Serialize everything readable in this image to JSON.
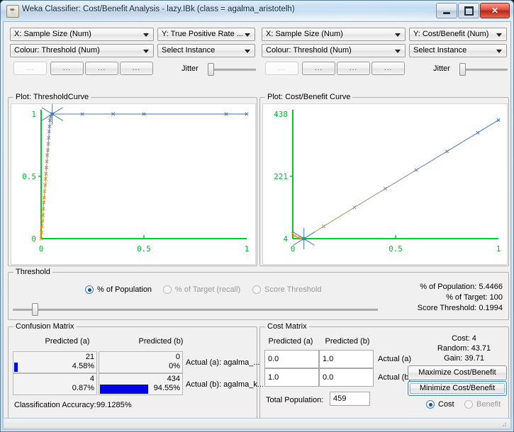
{
  "window": {
    "title": "Weka Classifier: Cost/Benefit Analysis - lazy.IBk  (class = agalma_aristotelh)",
    "icon": "weka-coffee-icon",
    "minimize": "minimize-icon",
    "maximize": "maximize-icon",
    "close": "✕"
  },
  "left_controls": {
    "x_axis": "X: Sample Size (Num)",
    "y_axis": "Y: True Positive Rate ...",
    "colour": "Colour: Threshold (Num)",
    "select_instance": "Select Instance",
    "buttons": [
      "...",
      "...",
      "...",
      "..."
    ],
    "jitter_label": "Jitter"
  },
  "right_controls": {
    "x_axis": "X: Sample Size (Num)",
    "y_axis": "Y: Cost/Benefit (Num)",
    "colour": "Colour: Threshold (Num)",
    "select_instance": "Select Instance",
    "buttons": [
      "...",
      "...",
      "...",
      "..."
    ],
    "jitter_label": "Jitter"
  },
  "threshold_panel": {
    "title": "Threshold",
    "options": [
      {
        "label": "% of Population",
        "selected": true
      },
      {
        "label": "% of Target (recall)",
        "selected": false
      },
      {
        "label": "Score Threshold",
        "selected": false
      }
    ],
    "stats": [
      "% of Population: 5.4466",
      "% of Target: 100",
      "Score Threshold: 0.1994"
    ]
  },
  "confusion_matrix": {
    "title": "Confusion Matrix",
    "col_headers": [
      "Predicted (a)",
      "Predicted (b)"
    ],
    "cells": [
      [
        {
          "count": "21",
          "percent": "4.58%",
          "bar": 4.58
        },
        {
          "count": "0",
          "percent": "0%",
          "bar": 0
        }
      ],
      [
        {
          "count": "4",
          "percent": "0.87%",
          "bar": 0.87
        },
        {
          "count": "434",
          "percent": "94.55%",
          "bar": 94.55
        }
      ]
    ],
    "row_labels": [
      "Actual (a): agalma_...",
      "Actual (b): agalma_k..."
    ],
    "accuracy_label": "Classification Accuracy:",
    "accuracy_value": "99.1285%"
  },
  "cost_matrix": {
    "title": "Cost Matrix",
    "col_headers": [
      "Predicted (a)",
      "Predicted (b)"
    ],
    "cells": [
      [
        "0.0",
        "1.0"
      ],
      [
        "1.0",
        "0.0"
      ]
    ],
    "row_labels": [
      "Actual (a)",
      "Actual (b)"
    ],
    "total_population_label": "Total Population:",
    "total_population_value": "459",
    "stats": [
      "Cost: 4",
      "Random: 43.71",
      "Gain: 39.71"
    ],
    "maximize_button": "Maximize Cost/Benefit",
    "minimize_button": "Minimize Cost/Benefit",
    "mode_options": [
      {
        "label": "Cost",
        "selected": true
      },
      {
        "label": "Benefit",
        "selected": false
      }
    ]
  },
  "chart_data": [
    {
      "type": "line",
      "title": "Plot: ThresholdCurve",
      "xlabel": "Sample Size",
      "ylabel": "True Positive Rate",
      "xlim": [
        0,
        1
      ],
      "ylim": [
        0,
        1
      ],
      "xticks": [
        "0",
        "0.5",
        "1"
      ],
      "yticks": [
        "0",
        "0.5",
        "1"
      ],
      "grid": false,
      "axis_color": "#00cc33",
      "tick_label_color": "#00bb33",
      "selected_point": {
        "x": 0.054,
        "y": 1.0
      },
      "series": [
        {
          "name": "ThresholdCurve",
          "colour_by": "Threshold (Num)",
          "x": [
            0.0,
            0.002,
            0.004,
            0.007,
            0.009,
            0.011,
            0.013,
            0.015,
            0.017,
            0.02,
            0.022,
            0.024,
            0.026,
            0.028,
            0.03,
            0.033,
            0.035,
            0.037,
            0.039,
            0.041,
            0.043,
            0.046,
            0.054,
            0.2,
            0.35,
            0.5,
            0.9,
            1.0
          ],
          "y": [
            0.0,
            0.05,
            0.1,
            0.14,
            0.19,
            0.24,
            0.29,
            0.33,
            0.38,
            0.43,
            0.48,
            0.52,
            0.57,
            0.62,
            0.67,
            0.71,
            0.76,
            0.81,
            0.86,
            0.9,
            0.95,
            0.98,
            1.0,
            1.0,
            1.0,
            1.0,
            1.0,
            1.0
          ]
        }
      ]
    },
    {
      "type": "line",
      "title": "Plot: Cost/Benefit Curve",
      "xlabel": "Sample Size",
      "ylabel": "Cost/Benefit",
      "xlim": [
        0,
        1
      ],
      "ylim": [
        4,
        438
      ],
      "xticks": [
        "0",
        "0.5",
        "1"
      ],
      "yticks": [
        "4",
        "221",
        "438"
      ],
      "grid": false,
      "axis_color": "#00cc33",
      "tick_label_color": "#00bb33",
      "selected_point": {
        "x": 0.054,
        "y": 4
      },
      "series": [
        {
          "name": "Cost/Benefit Curve",
          "colour_by": "Threshold (Num)",
          "x": [
            0.0,
            0.01,
            0.025,
            0.04,
            0.054,
            0.15,
            0.3,
            0.45,
            0.6,
            0.75,
            0.9,
            1.0
          ],
          "y": [
            22,
            14,
            8,
            5,
            4,
            47,
            113,
            178,
            243,
            308,
            373,
            417
          ]
        }
      ]
    }
  ]
}
